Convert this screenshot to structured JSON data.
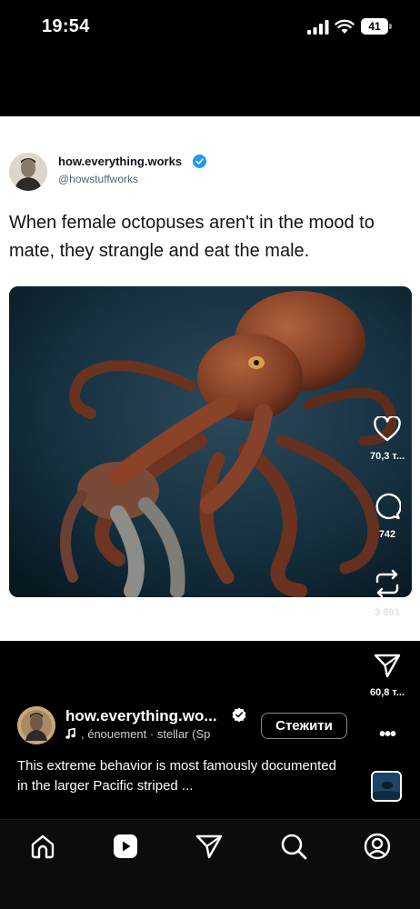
{
  "status_bar": {
    "time": "19:54",
    "battery": "41"
  },
  "tweet": {
    "display_name": "how.everything.works",
    "handle": "@howstuffworks",
    "text": "When female octopuses aren't in the mood to mate, they strangle and eat the male."
  },
  "actions": {
    "like_count": "70,3 т...",
    "comment_count": "742",
    "repost_count": "3 881",
    "share_count": "60,8 т..."
  },
  "reel": {
    "username": "how.everything.wo...",
    "music": ", énouement · stellar (Sp",
    "follow_label": "Стежити",
    "more_label": "•••",
    "caption": "This extreme behavior is most famously documented in the larger Pacific striped ..."
  },
  "colors": {
    "verified_blue": "#1d9bf0",
    "card_bg": "#ffffff",
    "app_bg": "#000000"
  },
  "icons": [
    "signal-icon",
    "wifi-icon",
    "battery-icon",
    "verified-icon",
    "heart-icon",
    "comment-icon",
    "repost-icon",
    "share-icon",
    "music-note-icon",
    "more-icon",
    "home-icon",
    "reels-icon",
    "send-icon",
    "search-icon",
    "profile-icon"
  ]
}
